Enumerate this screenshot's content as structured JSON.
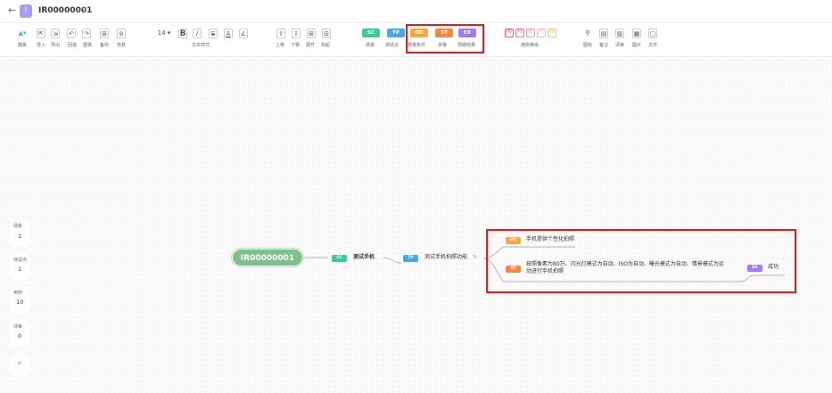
{
  "header": {
    "back_glyph": "←",
    "project_icon_letter": "I",
    "title": "IR00000001",
    "edit_glyph": "✎"
  },
  "toolbar": {
    "template_icon": "▲▾",
    "icon_group1": [
      "⇱",
      "⇲",
      "↶",
      "↷",
      "⊞",
      "⊘"
    ],
    "labels_group1": [
      "模板",
      "导入",
      "导出",
      "回退",
      "重做",
      "备份",
      "恢复"
    ],
    "font_size": "14 ▾",
    "text_icons": [
      "B",
      "I",
      "S",
      "A",
      "∠"
    ],
    "text_style_label": "文本样式",
    "icon_group2": [
      "⇧",
      "⇩",
      "⊞",
      "⊟"
    ],
    "labels_group2": [
      "上移",
      "下移",
      "展开",
      "收起"
    ],
    "tags_blue": [
      "SC",
      "TP"
    ],
    "labels_blue": [
      "场景",
      "测试点"
    ],
    "tags_highlighted": [
      "OD",
      "ST",
      "EX"
    ],
    "labels_highlighted": [
      "预置条件",
      "步骤",
      "预期结果"
    ],
    "priority_tags": [
      "P0",
      "P1",
      "P2",
      "P3",
      "P4"
    ],
    "priority_label": "用例等级",
    "icon_group3": [
      "⚲",
      "▤",
      "▥",
      "▦",
      "▢"
    ],
    "labels_group3": [
      "图标",
      "备注",
      "评审",
      "图片",
      "文件"
    ]
  },
  "stats": [
    {
      "label": "场景",
      "value": "1"
    },
    {
      "label": "测试点",
      "value": "1"
    },
    {
      "label": "用例",
      "value": "10"
    },
    {
      "label": "评审",
      "value": "0"
    }
  ],
  "collapse_glyph": "«",
  "mindmap": {
    "root": "IR00000001",
    "scene": {
      "tag": "SC",
      "text": "测试手机"
    },
    "test_point": {
      "tag": "TP",
      "text": "测试手机拍照功能",
      "edit_glyph": "✎"
    },
    "precondition": {
      "tag": "OD",
      "text": "手机提供个性化拍照"
    },
    "step": {
      "tag": "ST",
      "text": "按照像素为80万、闪光灯模式为自动、ISO为自动、曝光模式为自动、情景模式为运动进行手机拍照"
    },
    "expected": {
      "tag": "EX",
      "text": "成功"
    }
  },
  "colors": {
    "sc": "#3ec99a",
    "tp": "#4aa8e8",
    "od": "#f8a73c",
    "st": "#f5883f",
    "ex": "#a47be8",
    "root": "#7ec08e",
    "highlight": "#e01e24"
  }
}
